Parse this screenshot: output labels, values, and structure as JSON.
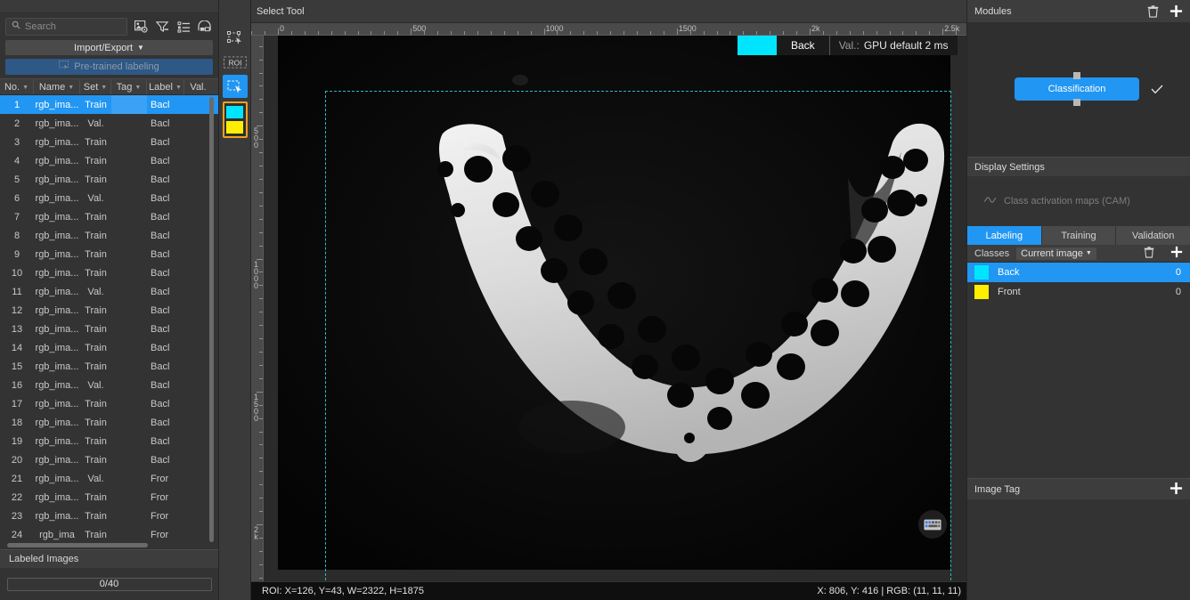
{
  "left": {
    "search": {
      "placeholder": "Search",
      "value": ""
    },
    "toolbar_icons": [
      "image-settings-icon",
      "filter-icon",
      "list-view-icon",
      "thumbnail-view-icon"
    ],
    "import_export_label": "Import/Export",
    "pretrained_label": "Pre-trained labeling",
    "columns": [
      "No.",
      "Name",
      "Set",
      "Tag",
      "Label",
      "Val."
    ],
    "rows": [
      {
        "no": "1",
        "name": "rgb_ima...",
        "set": "Train",
        "tag": "",
        "label": "Bacl",
        "val": ""
      },
      {
        "no": "2",
        "name": "rgb_ima...",
        "set": "Val.",
        "tag": "",
        "label": "Bacl",
        "val": ""
      },
      {
        "no": "3",
        "name": "rgb_ima...",
        "set": "Train",
        "tag": "",
        "label": "Bacl",
        "val": ""
      },
      {
        "no": "4",
        "name": "rgb_ima...",
        "set": "Train",
        "tag": "",
        "label": "Bacl",
        "val": ""
      },
      {
        "no": "5",
        "name": "rgb_ima...",
        "set": "Train",
        "tag": "",
        "label": "Bacl",
        "val": ""
      },
      {
        "no": "6",
        "name": "rgb_ima...",
        "set": "Val.",
        "tag": "",
        "label": "Bacl",
        "val": ""
      },
      {
        "no": "7",
        "name": "rgb_ima...",
        "set": "Train",
        "tag": "",
        "label": "Bacl",
        "val": ""
      },
      {
        "no": "8",
        "name": "rgb_ima...",
        "set": "Train",
        "tag": "",
        "label": "Bacl",
        "val": ""
      },
      {
        "no": "9",
        "name": "rgb_ima...",
        "set": "Train",
        "tag": "",
        "label": "Bacl",
        "val": ""
      },
      {
        "no": "10",
        "name": "rgb_ima...",
        "set": "Train",
        "tag": "",
        "label": "Bacl",
        "val": ""
      },
      {
        "no": "11",
        "name": "rgb_ima...",
        "set": "Val.",
        "tag": "",
        "label": "Bacl",
        "val": ""
      },
      {
        "no": "12",
        "name": "rgb_ima...",
        "set": "Train",
        "tag": "",
        "label": "Bacl",
        "val": ""
      },
      {
        "no": "13",
        "name": "rgb_ima...",
        "set": "Train",
        "tag": "",
        "label": "Bacl",
        "val": ""
      },
      {
        "no": "14",
        "name": "rgb_ima...",
        "set": "Train",
        "tag": "",
        "label": "Bacl",
        "val": ""
      },
      {
        "no": "15",
        "name": "rgb_ima...",
        "set": "Train",
        "tag": "",
        "label": "Bacl",
        "val": ""
      },
      {
        "no": "16",
        "name": "rgb_ima...",
        "set": "Val.",
        "tag": "",
        "label": "Bacl",
        "val": ""
      },
      {
        "no": "17",
        "name": "rgb_ima...",
        "set": "Train",
        "tag": "",
        "label": "Bacl",
        "val": ""
      },
      {
        "no": "18",
        "name": "rgb_ima...",
        "set": "Train",
        "tag": "",
        "label": "Bacl",
        "val": ""
      },
      {
        "no": "19",
        "name": "rgb_ima...",
        "set": "Train",
        "tag": "",
        "label": "Bacl",
        "val": ""
      },
      {
        "no": "20",
        "name": "rgb_ima...",
        "set": "Train",
        "tag": "",
        "label": "Bacl",
        "val": ""
      },
      {
        "no": "21",
        "name": "rgb_ima...",
        "set": "Val.",
        "tag": "",
        "label": "Fror",
        "val": ""
      },
      {
        "no": "22",
        "name": "rgb_ima...",
        "set": "Train",
        "tag": "",
        "label": "Fror",
        "val": ""
      },
      {
        "no": "23",
        "name": "rgb_ima...",
        "set": "Train",
        "tag": "",
        "label": "Fror",
        "val": ""
      },
      {
        "no": "24",
        "name": "rgb_ima",
        "set": "Train",
        "tag": "",
        "label": "Fror",
        "val": ""
      }
    ],
    "labeled_images_title": "Labeled Images",
    "labeled_images_progress": "0/40"
  },
  "tools": {
    "items": [
      {
        "name": "polygon-select-tool",
        "label": ""
      },
      {
        "name": "roi-tool",
        "label": "ROI"
      },
      {
        "name": "select-tool",
        "label": ""
      }
    ],
    "swatches": [
      "#00e5ff",
      "#ffee00"
    ]
  },
  "center": {
    "tool_title": "Select Tool",
    "ruler_h_labels": [
      "0",
      "500",
      "1000",
      "1500",
      "2k",
      "2.5k"
    ],
    "ruler_v_labels": [
      "500",
      "1000",
      "1500",
      "2k"
    ],
    "overlay": {
      "class_color": "#00e5ff",
      "class_name": "Back",
      "val_prefix": "Val.:",
      "val_text": "GPU default 2 ms"
    },
    "keyboard_icon": "keyboard-shortcuts-icon",
    "status_left": "ROI: X=126, Y=43, W=2322, H=1875",
    "status_right": "X: 806, Y: 416 | RGB: (11, 11, 11)"
  },
  "right": {
    "modules": {
      "title": "Modules",
      "node_label": "Classification",
      "delete_icon": "trash-icon",
      "add_icon": "plus-icon",
      "check_icon": "check-icon"
    },
    "display_settings": {
      "title": "Display Settings",
      "cam_label": "Class activation maps (CAM)",
      "cam_icon": "activation-curve-icon"
    },
    "tabs": [
      {
        "label": "Labeling",
        "active": true
      },
      {
        "label": "Training",
        "active": false
      },
      {
        "label": "Validation",
        "active": false
      }
    ],
    "classes_bar": {
      "title": "Classes",
      "scope_dropdown": "Current image",
      "delete_icon": "trash-icon",
      "add_icon": "plus-icon"
    },
    "classes": [
      {
        "color": "#00e5ff",
        "name": "Back",
        "count": "0",
        "selected": true
      },
      {
        "color": "#ffee00",
        "name": "Front",
        "count": "0",
        "selected": false
      }
    ],
    "image_tag": {
      "title": "Image Tag",
      "add_icon": "plus-icon"
    }
  }
}
